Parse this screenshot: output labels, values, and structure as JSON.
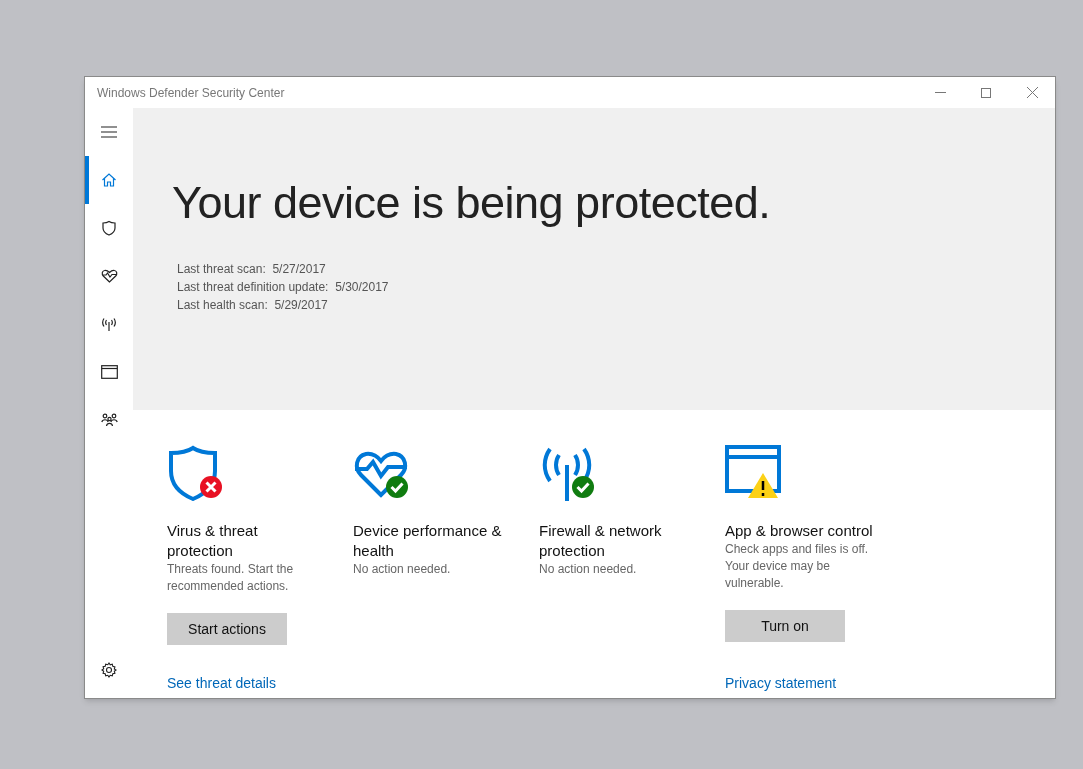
{
  "window": {
    "title": "Windows Defender Security Center"
  },
  "sidebar": {
    "items": [
      {
        "kind": "home",
        "selected": true
      },
      {
        "kind": "shield",
        "selected": false
      },
      {
        "kind": "heart",
        "selected": false
      },
      {
        "kind": "antenna",
        "selected": false
      },
      {
        "kind": "browser",
        "selected": false
      },
      {
        "kind": "family",
        "selected": false
      }
    ]
  },
  "hero": {
    "title": "Your device is being protected.",
    "details": [
      {
        "label": "Last threat scan:",
        "value": "5/27/2017"
      },
      {
        "label": "Last threat definition update:",
        "value": "5/30/2017"
      },
      {
        "label": "Last health scan:",
        "value": "5/29/2017"
      }
    ]
  },
  "cards": [
    {
      "kind": "error",
      "title": "Virus & threat protection",
      "description": "Threats found. Start the recommended actions.",
      "button": "Start actions",
      "link": "See threat details"
    },
    {
      "kind": "ok",
      "title": "Device performance & health",
      "description": "No action needed."
    },
    {
      "kind": "ok",
      "title": "Firewall & network protection",
      "description": "No action needed."
    },
    {
      "kind": "warning",
      "title": "App & browser control",
      "description": "Check apps and files is off. Your device may be vulnerable.",
      "button": "Turn on",
      "link": "Privacy statement"
    }
  ]
}
